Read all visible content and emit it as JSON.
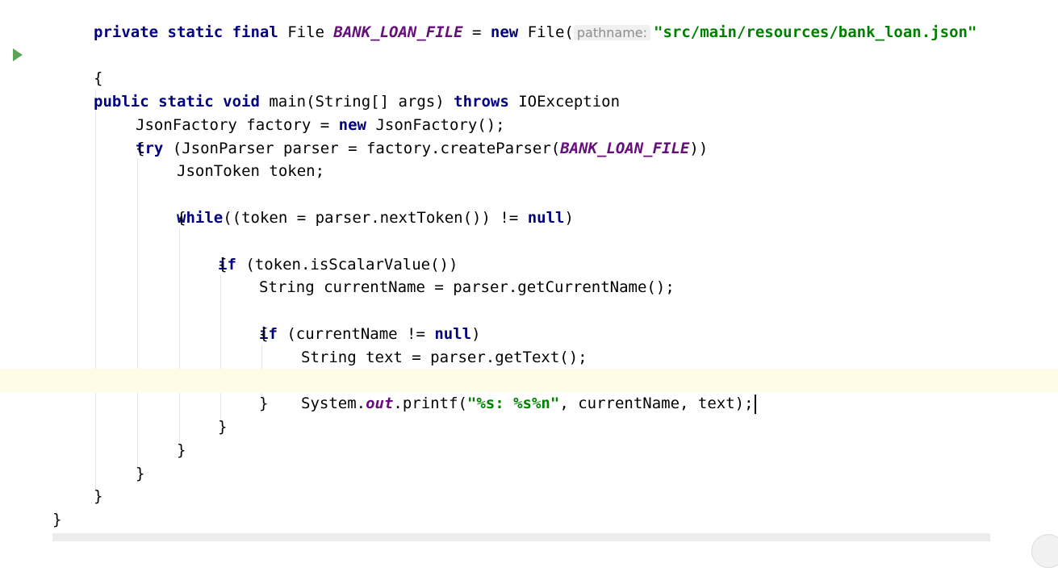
{
  "editor": {
    "line1": {
      "kw1": "private static final",
      "plain1": " File ",
      "const1": "BANK_LOAN_FILE",
      "plain2": " = ",
      "kw2": "new",
      "plain3": " File(",
      "hint": "pathname:",
      "str1": "\"src/main/resources/bank_loan.json\""
    },
    "line2": {
      "kw1": "public static void",
      "plain1": " main(String[] args) ",
      "kw2": "throws",
      "plain2": " IOException"
    },
    "line3": {
      "text": "{"
    },
    "line4": {
      "plain1": "JsonFactory factory = ",
      "kw1": "new",
      "plain2": " JsonFactory();"
    },
    "line5": {
      "kw1": "try",
      "plain1": " (JsonParser parser = factory.createParser(",
      "const1": "BANK_LOAN_FILE",
      "plain2": "))"
    },
    "line6": {
      "text": "{"
    },
    "line7": {
      "text": "JsonToken token;"
    },
    "line8": {
      "kw1": "while",
      "plain1": "((token = parser.nextToken()) != ",
      "kw2": "null",
      "plain2": ")"
    },
    "line9": {
      "text": "{"
    },
    "line10": {
      "kw1": "if",
      "plain1": " (token.isScalarValue())"
    },
    "line11": {
      "text": "{"
    },
    "line12": {
      "text": "String currentName = parser.getCurrentName();"
    },
    "line13": {
      "kw1": "if",
      "plain1": " (currentName != ",
      "kw2": "null",
      "plain2": ")"
    },
    "line14": {
      "text": "{"
    },
    "line15": {
      "text": "String text = parser.getText();"
    },
    "line16": {
      "plain1": "System.",
      "const1": "out",
      "plain2": ".printf(",
      "str1": "\"%s: %s%n\"",
      "plain3": ", currentName, text);"
    },
    "line17": {
      "text": "}"
    },
    "line18": {
      "text": "}"
    },
    "line19": {
      "text": "}"
    },
    "line20": {
      "text": "}"
    },
    "line21": {
      "text": "}"
    },
    "line22": {
      "text": "}"
    }
  },
  "colors": {
    "keyword": "#000080",
    "constant": "#660e7a",
    "string": "#008000",
    "current_line": "#fefbe6",
    "run_marker": "#5aa35a"
  },
  "icons": {
    "run_gutter": "run-gutter-icon"
  }
}
